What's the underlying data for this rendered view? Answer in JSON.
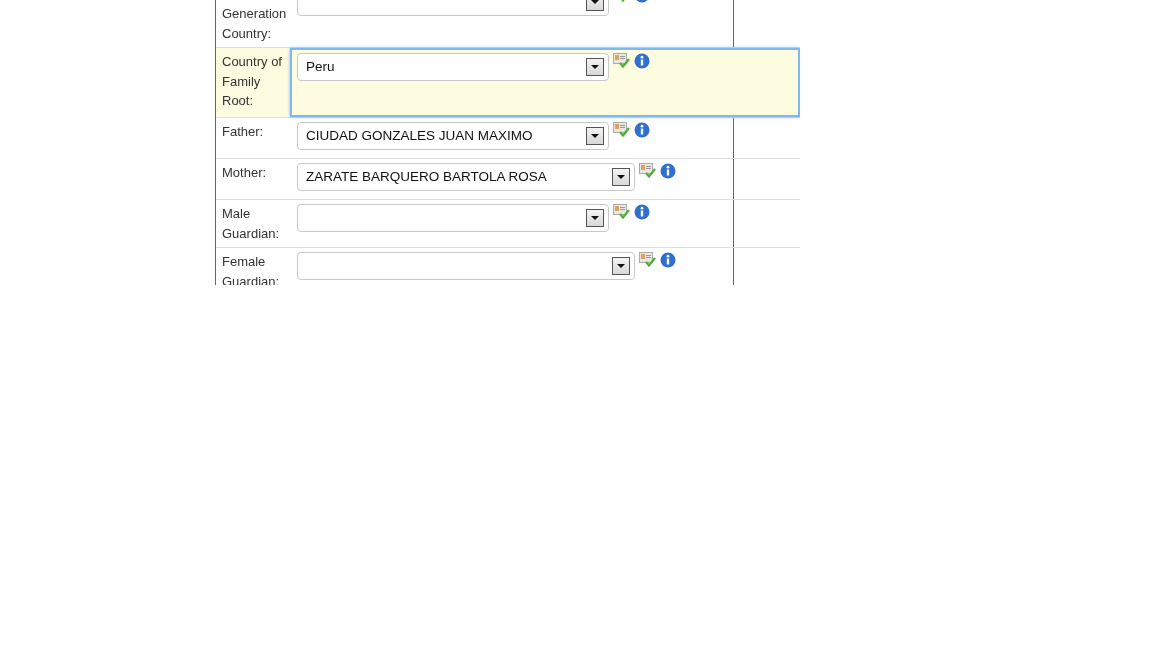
{
  "form_rows": [
    {
      "label": "Generation Country:",
      "kind": "narrow",
      "focused": false
    },
    {
      "label": "Country of Family Root:",
      "value": "Peru",
      "kind": "narrow",
      "focused": true
    },
    {
      "label": "Father:",
      "value": "CIUDAD GONZALES JUAN MAXIMO",
      "kind": "narrow",
      "focused": false
    },
    {
      "label": "Mother:",
      "value": "ZARATE BARQUERO BARTOLA ROSA",
      "kind": "wide",
      "focused": false
    },
    {
      "label": "Male Guardian:",
      "kind": "narrow",
      "focused": false
    },
    {
      "label": "Female Guardian:",
      "kind": "wide",
      "focused": false
    }
  ]
}
